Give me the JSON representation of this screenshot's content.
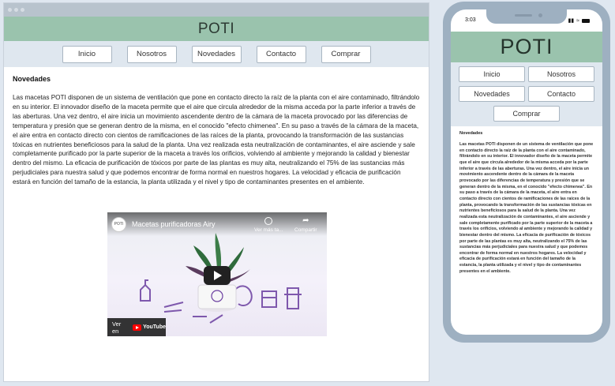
{
  "brand": "POTI",
  "nav": [
    "Inicio",
    "Nosotros",
    "Novedades",
    "Contacto",
    "Comprar"
  ],
  "section_title": "Novedades",
  "body_text": "Las macetas POTI disponen de un sistema de ventilación que pone en contacto directo la raíz de la planta con el aire contaminado, filtrándolo en su interior. El innovador diseño de la maceta permite que el aire que circula alrededor de la misma acceda por la parte inferior a través de las aberturas. Una vez dentro, el aire inicia un movimiento ascendente dentro de la cámara de la maceta provocado por las diferencias de temperatura y presión que se generan dentro de la misma, en el conocido \"efecto chimenea\". En su paso a través de la cámara de la maceta, el aire entra en contacto directo con cientos de ramificaciones de las raíces de la planta, provocando la transformación de las sustancias tóxicas en nutrientes beneficiosos para la salud de la planta. Una vez realizada esta neutralización de contaminantes, el aire asciende y sale completamente purificado por la parte superior de la maceta a través los orificios, volviendo al ambiente y mejorando la calidad y bienestar dentro del mismo. La eficacia de purificación de tóxicos por parte de las plantas es muy alta, neutralizando el 75% de las sustancias más perjudiciales para nuestra salud y que podemos encontrar de forma normal en nuestros hogares. La velocidad y eficacia de purificación estará en función del tamaño de la estancia, la planta utilizada y el nivel y tipo de contaminantes presentes en el ambiente.",
  "video": {
    "title": "Macetas purificadoras Airy",
    "watch_later": "Ver más ta...",
    "share": "Compartir",
    "watch_on": "Ver en",
    "platform": "YouTube"
  },
  "phone": {
    "time": "3:03"
  },
  "colors": {
    "banner": "#9ac3ad",
    "nav_bg": "#dfe7ef",
    "phone_frame": "#9eb0c1"
  }
}
